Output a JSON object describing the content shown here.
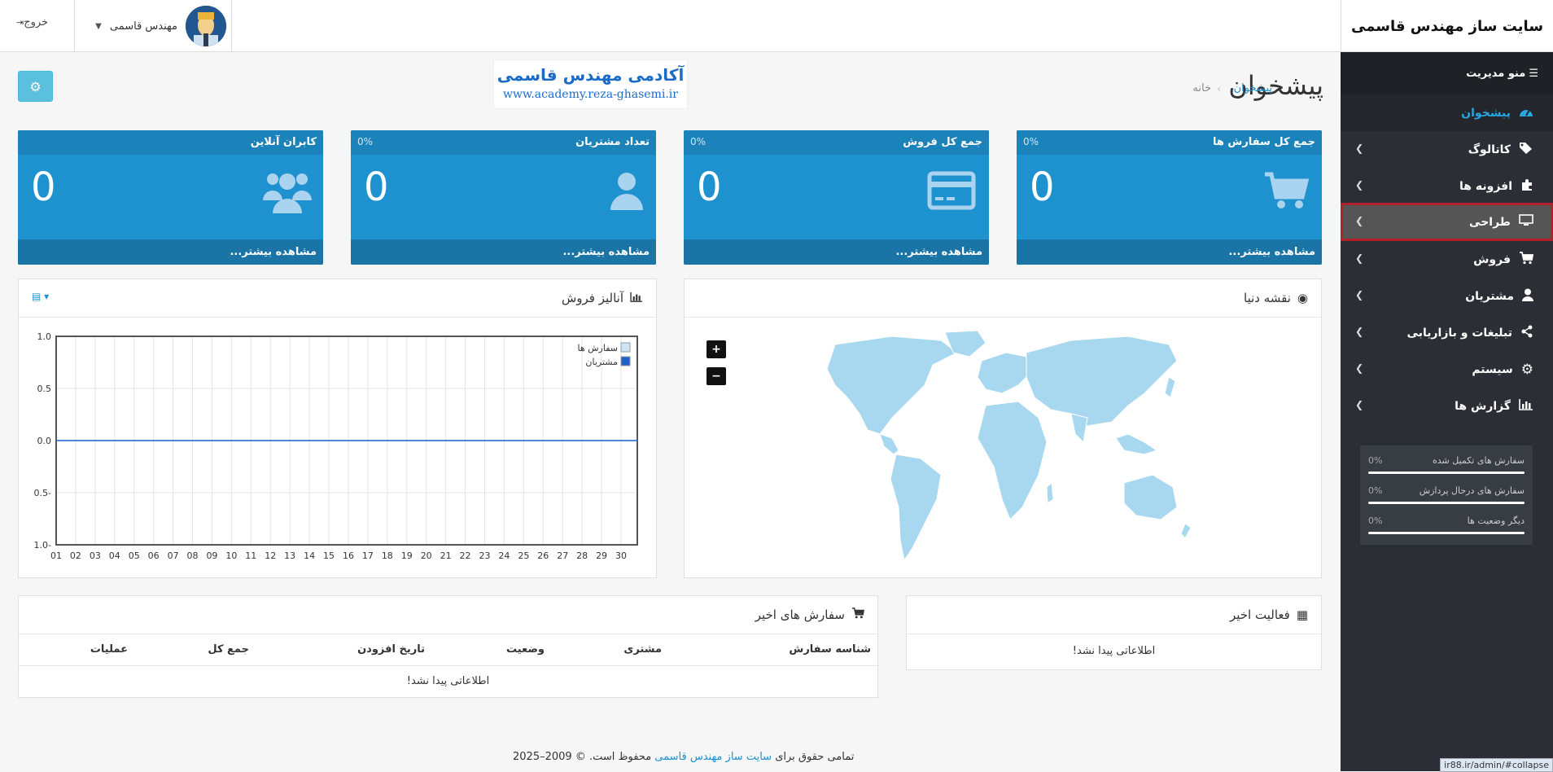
{
  "header": {
    "brand": "سایت ساز مهندس قاسمی",
    "user_name": "مهندس قاسمی",
    "logout_label": "خروج"
  },
  "sidebar": {
    "menu_title": "منو مدیریت",
    "items": [
      {
        "label": "پیشخوان",
        "icon": "dashboard-icon"
      },
      {
        "label": "کاتالوگ",
        "icon": "tags-icon"
      },
      {
        "label": "افزونه ها",
        "icon": "puzzle-icon"
      },
      {
        "label": "طراحی",
        "icon": "desktop-icon"
      },
      {
        "label": "فروش",
        "icon": "cart-icon"
      },
      {
        "label": "مشتریان",
        "icon": "user-icon"
      },
      {
        "label": "تبلیغات و بازاریابی",
        "icon": "share-icon"
      },
      {
        "label": "سیستم",
        "icon": "gear-icon"
      },
      {
        "label": "گزارش ها",
        "icon": "bar-chart-icon"
      }
    ],
    "stats": [
      {
        "label": "سفارش های تکمیل شده",
        "percent": "0%"
      },
      {
        "label": "سفارش های درحال پردازش",
        "percent": "0%"
      },
      {
        "label": "دیگر وضعیت ها",
        "percent": "0%"
      }
    ]
  },
  "page": {
    "title": "پیشخوان",
    "breadcrumb_home": "خانه",
    "breadcrumb_current": "پیشخوان",
    "banner_title": "آکادمی مهندس قاسمی",
    "banner_url": "www.academy.reza-ghasemi.ir"
  },
  "tiles": [
    {
      "title": "جمع کل سفارش ها",
      "percent": "0%",
      "value": "0",
      "more": "مشاهده بیشتر...",
      "icon": "cart-icon"
    },
    {
      "title": "جمع کل فروش",
      "percent": "0%",
      "value": "0",
      "more": "مشاهده بیشتر...",
      "icon": "credit-card-icon"
    },
    {
      "title": "تعداد مشتریان",
      "percent": "0%",
      "value": "0",
      "more": "مشاهده بیشتر...",
      "icon": "user-icon"
    },
    {
      "title": "کابران آنلاین",
      "percent": "",
      "value": "0",
      "more": "مشاهده بیشتر...",
      "icon": "users-icon"
    }
  ],
  "map_panel": {
    "title": "نقشه دنیا",
    "zoom_in": "+",
    "zoom_out": "−"
  },
  "chart_panel": {
    "title": "آنالیز فروش"
  },
  "chart_data": {
    "type": "line",
    "x": [
      "01",
      "02",
      "03",
      "04",
      "05",
      "06",
      "07",
      "08",
      "09",
      "10",
      "11",
      "12",
      "13",
      "14",
      "15",
      "16",
      "17",
      "18",
      "19",
      "20",
      "21",
      "22",
      "23",
      "24",
      "25",
      "26",
      "27",
      "28",
      "29",
      "30"
    ],
    "ylim": [
      -1.0,
      1.0
    ],
    "yticks": [
      "1.0",
      "0.5",
      "0.0",
      "0.5-",
      "1.0-"
    ],
    "series": [
      {
        "name": "سفارش ها",
        "color": "#cde4f6",
        "values": [
          0,
          0,
          0,
          0,
          0,
          0,
          0,
          0,
          0,
          0,
          0,
          0,
          0,
          0,
          0,
          0,
          0,
          0,
          0,
          0,
          0,
          0,
          0,
          0,
          0,
          0,
          0,
          0,
          0,
          0
        ]
      },
      {
        "name": "مشتریان",
        "color": "#1e64c8",
        "values": [
          0,
          0,
          0,
          0,
          0,
          0,
          0,
          0,
          0,
          0,
          0,
          0,
          0,
          0,
          0,
          0,
          0,
          0,
          0,
          0,
          0,
          0,
          0,
          0,
          0,
          0,
          0,
          0,
          0,
          0
        ]
      }
    ],
    "legend": "top-right",
    "grid": true
  },
  "activity": {
    "title": "فعالیت اخیر",
    "empty": "اطلاعاتی پیدا نشد!"
  },
  "orders": {
    "title": "سفارش های اخیر",
    "columns": [
      "شناسه سفارش",
      "مشتری",
      "وضعیت",
      "تاریخ افزودن",
      "جمع کل",
      "عملیات"
    ],
    "empty": "اطلاعاتی پیدا نشد!"
  },
  "footer": {
    "text_prefix": "تمامی حقوق برای",
    "link": "سایت ساز مهندس قاسمی",
    "text_suffix": "محفوظ است. © 2009–2025"
  },
  "status_url": "ir88.ir/admin/#collapse"
}
